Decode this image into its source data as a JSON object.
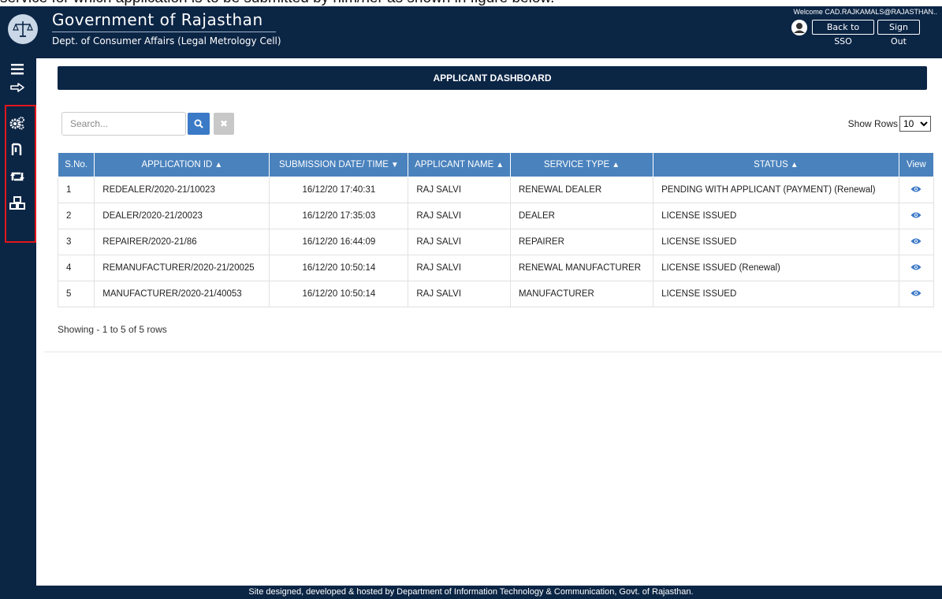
{
  "doc_text": "service for which application is to be submitted by him/her as shown in figure below.",
  "header": {
    "title": "Government of Rajasthan",
    "subtitle": "Dept. of Consumer Affairs (Legal Metrology Cell)",
    "welcome": "Welcome CAD.RAJKAMALS@RAJASTHAN..",
    "back_label": "Back to SSO",
    "signout_label": "Sign Out"
  },
  "sidebar": {
    "items": [
      {
        "icon": "hamburger-menu-icon"
      },
      {
        "icon": "hand-pointer-icon"
      },
      {
        "icon": "gears-icon"
      },
      {
        "icon": "rupee-icon"
      },
      {
        "icon": "retweet-icon"
      },
      {
        "icon": "cubes-icon"
      }
    ]
  },
  "dashboard": {
    "title": "APPLICANT DASHBOARD",
    "search_placeholder": "Search...",
    "clear_glyph": "✖",
    "show_rows_label": "Show Rows",
    "rows_value": "10",
    "columns": [
      "S.No.",
      "APPLICATION ID",
      "SUBMISSION DATE/ TIME",
      "APPLICANT NAME",
      "SERVICE TYPE",
      "STATUS",
      "View"
    ],
    "rows": [
      {
        "sno": "1",
        "app_id": "REDEALER/2020-21/10023",
        "date": "16/12/20 17:40:31",
        "name": "RAJ SALVI",
        "service": "RENEWAL DEALER",
        "status": "PENDING WITH APPLICANT (PAYMENT) (Renewal)"
      },
      {
        "sno": "2",
        "app_id": "DEALER/2020-21/20023",
        "date": "16/12/20 17:35:03",
        "name": "RAJ SALVI",
        "service": "DEALER",
        "status": "LICENSE ISSUED"
      },
      {
        "sno": "3",
        "app_id": "REPAIRER/2020-21/86",
        "date": "16/12/20 16:44:09",
        "name": "RAJ SALVI",
        "service": "REPAIRER",
        "status": "LICENSE ISSUED"
      },
      {
        "sno": "4",
        "app_id": "REMANUFACTURER/2020-21/20025",
        "date": "16/12/20 10:50:14",
        "name": "RAJ SALVI",
        "service": "RENEWAL MANUFACTURER",
        "status": "LICENSE ISSUED (Renewal)"
      },
      {
        "sno": "5",
        "app_id": "MANUFACTURER/2020-21/40053",
        "date": "16/12/20 10:50:14",
        "name": "RAJ SALVI",
        "service": "MANUFACTURER",
        "status": "LICENSE ISSUED"
      }
    ],
    "showing_text": "Showing - 1 to 5 of 5 rows"
  },
  "footer": {
    "text": "Site designed, developed & hosted by Department of Information Technology & Communication, Govt. of Rajasthan."
  },
  "colors": {
    "navy": "#0b2545",
    "table_header": "#4a82bd",
    "search_button": "#3b7ac6",
    "highlight": "#e0161b"
  }
}
